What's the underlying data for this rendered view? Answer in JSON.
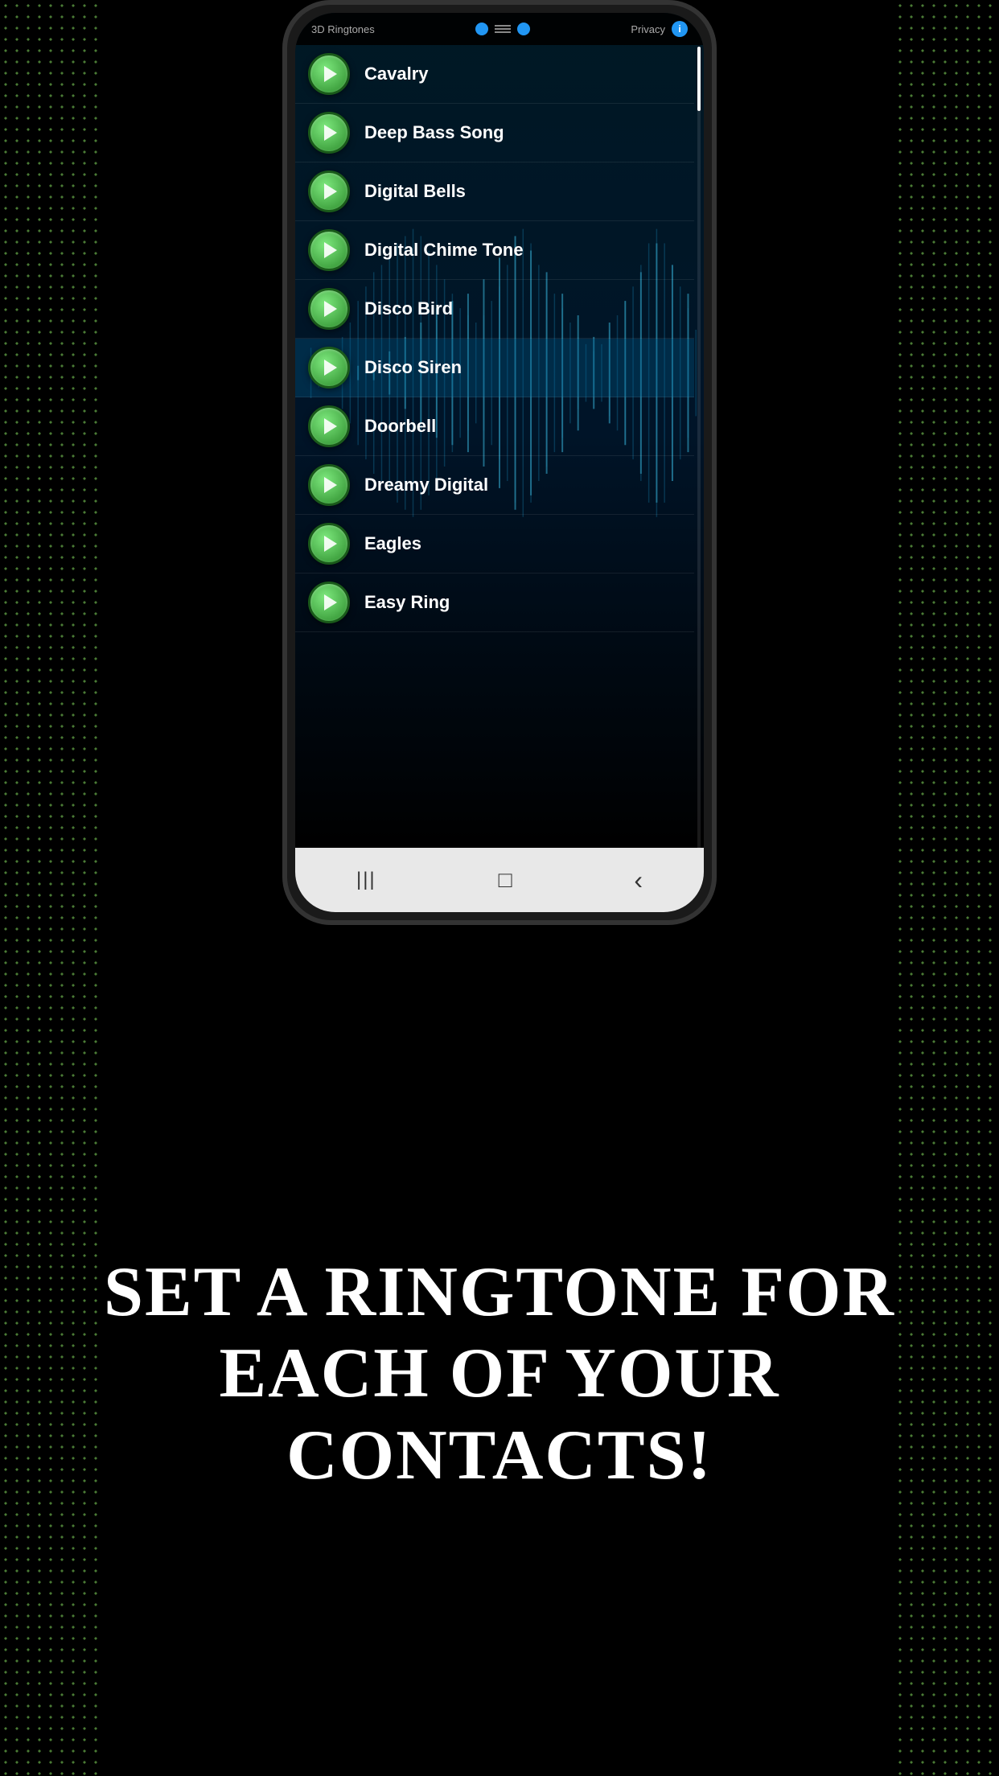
{
  "app": {
    "title": "3D Ringtones",
    "topbar": {
      "left_label": "3D Ringtones",
      "privacy_label": "Privacy",
      "info_label": "i"
    }
  },
  "ringtones": [
    {
      "id": 1,
      "name": "Cavalry",
      "active": false
    },
    {
      "id": 2,
      "name": "Deep Bass Song",
      "active": false
    },
    {
      "id": 3,
      "name": "Digital Bells",
      "active": false
    },
    {
      "id": 4,
      "name": "Digital Chime Tone",
      "active": false
    },
    {
      "id": 5,
      "name": "Disco Bird",
      "active": false
    },
    {
      "id": 6,
      "name": "Disco Siren",
      "active": true
    },
    {
      "id": 7,
      "name": "Doorbell",
      "active": false
    },
    {
      "id": 8,
      "name": "Dreamy Digital",
      "active": false
    },
    {
      "id": 9,
      "name": "Eagles",
      "active": false
    },
    {
      "id": 10,
      "name": "Easy Ring",
      "active": false
    }
  ],
  "navigation": {
    "menu_icon": "≡",
    "home_icon": "□",
    "back_icon": "‹"
  },
  "promo": {
    "text": "Set a ringtone for each of your contacts!"
  },
  "colors": {
    "play_green_start": "#7de87d",
    "play_green_end": "#2a8a2a",
    "accent_blue": "#2196F3",
    "background": "#000000",
    "dots_green": "#6ab04c"
  }
}
